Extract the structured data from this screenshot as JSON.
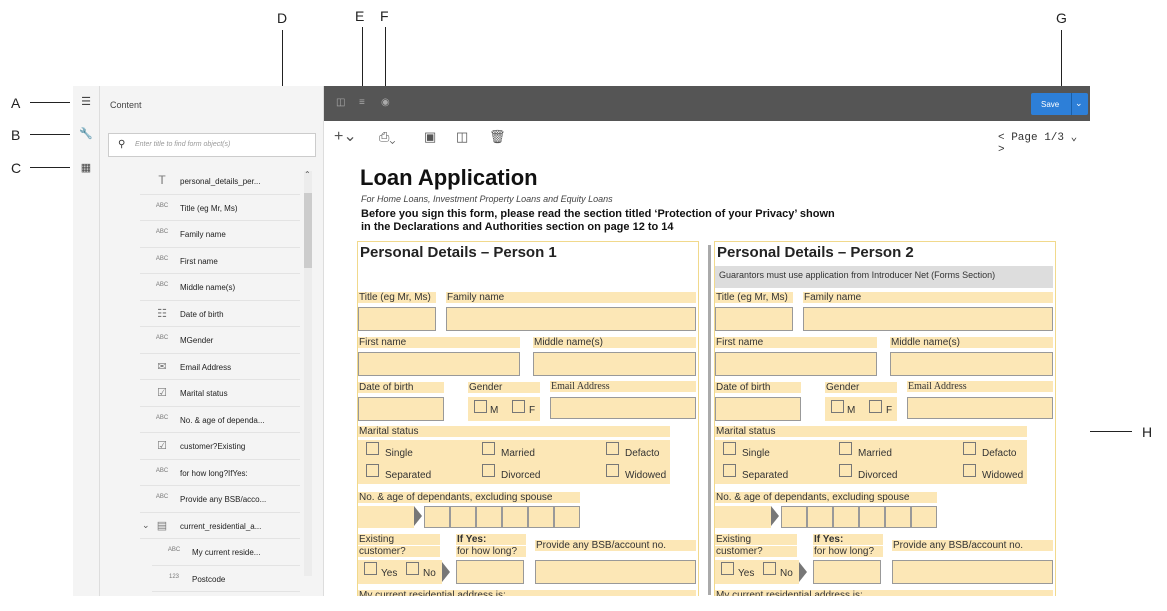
{
  "callouts": [
    "A",
    "B",
    "C",
    "D",
    "E",
    "F",
    "G",
    "H"
  ],
  "sidebar": {
    "header": "Content",
    "search_placeholder": "Enter title to find form object(s)",
    "items": [
      {
        "icon": "T",
        "label": "personal_details_per..."
      },
      {
        "icon": "ABC",
        "label": "Title (eg Mr, Ms)"
      },
      {
        "icon": "ABC",
        "label": "Family name"
      },
      {
        "icon": "ABC",
        "label": "First name"
      },
      {
        "icon": "ABC",
        "label": "Middle name(s)"
      },
      {
        "icon": "calendar-icon",
        "label": "Date of birth"
      },
      {
        "icon": "ABC",
        "label": "MGender"
      },
      {
        "icon": "email-icon",
        "label": "Email Address"
      },
      {
        "icon": "checkbox-icon",
        "label": "Marital status"
      },
      {
        "icon": "ABC",
        "label": "No. & age of dependa..."
      },
      {
        "icon": "checkbox-icon",
        "label": "customer?Existing"
      },
      {
        "icon": "ABC",
        "label": "for how long?IfYes:"
      },
      {
        "icon": "ABC",
        "label": "Provide any BSB/acco..."
      },
      {
        "icon": "panel-icon",
        "label": "current_residential_a..."
      },
      {
        "icon": "ABC",
        "label": "My current reside..."
      },
      {
        "icon": "123",
        "label": "Postcode"
      }
    ]
  },
  "toolbar": {
    "save_label": "Save",
    "pager": "< Page 1/3 ⌄ >"
  },
  "doc": {
    "title": "Loan Application",
    "subtitle": "For Home Loans, Investment Property Loans and Equity Loans",
    "notice1": "Before you sign this form, please read the section titled ‘Protection of your Privacy’ shown",
    "notice2": "in the Declarations and Authorities section on page 12 to 14",
    "person1": "Personal Details – Person 1",
    "person2": "Personal Details – Person 2",
    "guarantors": "Guarantors must use application from Introducer Net (Forms Section)",
    "labels": {
      "title": "Title (eg Mr, Ms)",
      "family": "Family name",
      "first": "First name",
      "middle": "Middle name(s)",
      "dob": "Date of birth",
      "gender": "Gender",
      "email": "Email Address",
      "marital": "Marital status",
      "single": "Single",
      "married": "Married",
      "defacto": "Defacto",
      "separated": "Separated",
      "divorced": "Divorced",
      "widowed": "Widowed",
      "dependants": "No. & age of dependants, excluding spouse",
      "existing": "Existing",
      "customer": "customer?",
      "ifyes": "If Yes:",
      "howlong": "for how long?",
      "bsb": "Provide any BSB/account no.",
      "yes": "Yes",
      "no": "No",
      "m": "M",
      "f": "F",
      "residential": "My current residential address is:"
    }
  }
}
